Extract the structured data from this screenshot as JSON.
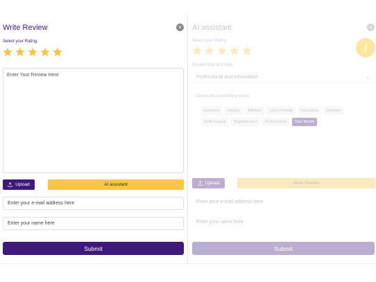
{
  "write_review": {
    "title": "Write Review",
    "rating_label": "Select your Rating",
    "rating": {
      "value": 5,
      "max": 5
    },
    "review_placeholder": "Enter Your Review Here",
    "upload_label": "Upload",
    "ai_assistant_label": "AI assistant",
    "email_placeholder": "Enter your e-mail address here",
    "name_placeholder": "Enter your name here",
    "submit_label": "Submit"
  },
  "ai_assistant": {
    "title": "AI assistant",
    "rating_label": "Select your Rating",
    "tone_label": "Review tone and style",
    "tone_value": "Professional and informative",
    "words_label": "Select best describing words",
    "words": [
      "Excellent",
      "Helpful",
      "Efficient",
      "User-Friendly",
      "Innovative",
      "Reliable",
      "Multi-Lingual",
      "Sophisticated",
      "Professional",
      "Own Words"
    ],
    "active_word": "Own Words",
    "upload_label": "Upload",
    "write_review_label": "Write Review",
    "email_placeholder": "Enter your e-mail address here",
    "name_placeholder": "Enter your name here",
    "submit_label": "Submit",
    "info_symbol": "i"
  },
  "icons": {
    "close": "×",
    "chevron": "⌄"
  },
  "colors": {
    "brand": "#3f1a7a",
    "star": "#f7c54a",
    "accent": "#f7c54a"
  }
}
